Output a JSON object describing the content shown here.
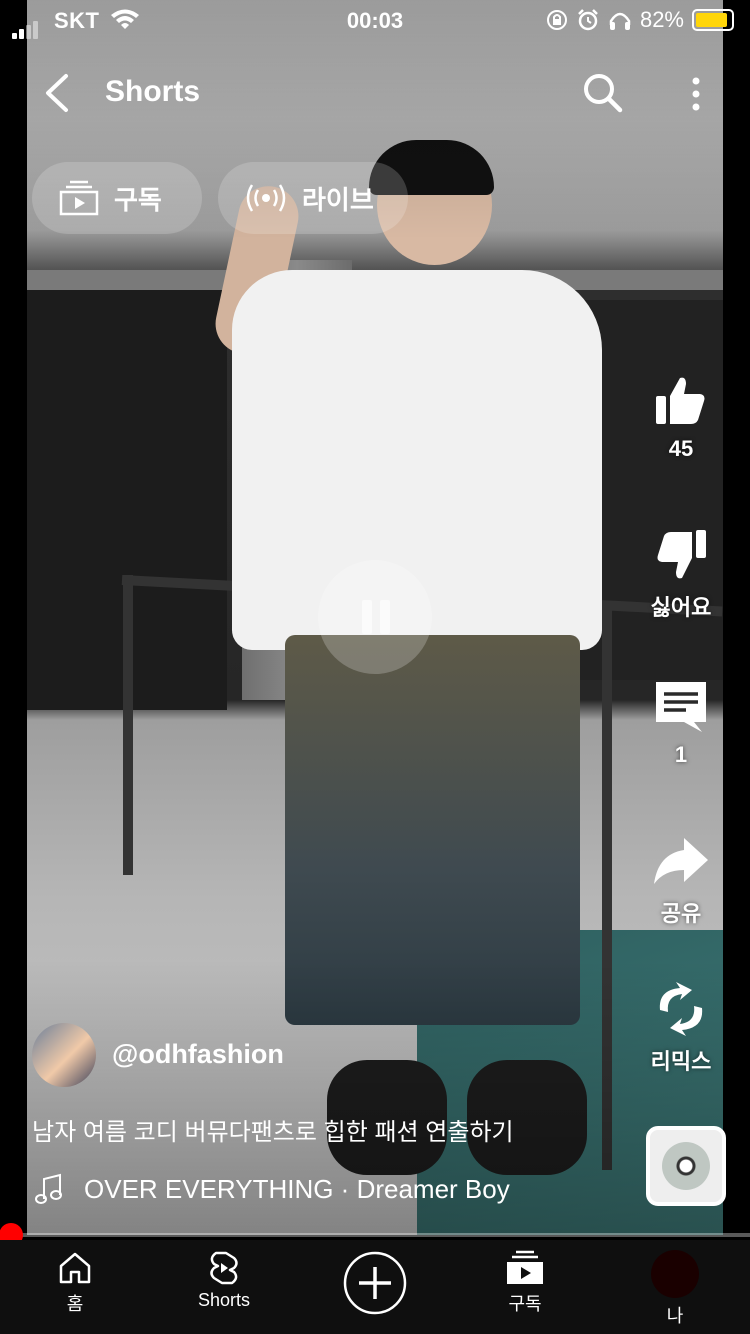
{
  "status": {
    "carrier": "SKT",
    "time": "00:03",
    "battery": "82%"
  },
  "header": {
    "title": "Shorts"
  },
  "chips": {
    "subscriptions": "구독",
    "live": "라이브"
  },
  "actions": {
    "like_count": "45",
    "dislike_label": "싫어요",
    "comment_count": "1",
    "share_label": "공유",
    "remix_label": "리믹스"
  },
  "video": {
    "channel_handle": "@odhfashion",
    "description": "남자 여름 코디 버뮤다팬츠로 힙한 패션 연출하기",
    "music": "OVER EVERYTHING · Dreamer Boy",
    "progress": 0.015
  },
  "nav": {
    "home": "홈",
    "shorts": "Shorts",
    "subscriptions": "구독",
    "me": "나"
  },
  "colors": {
    "accent": "#ff0000",
    "battery": "#ffd60a",
    "nav_bg": "#0f0f0f"
  }
}
